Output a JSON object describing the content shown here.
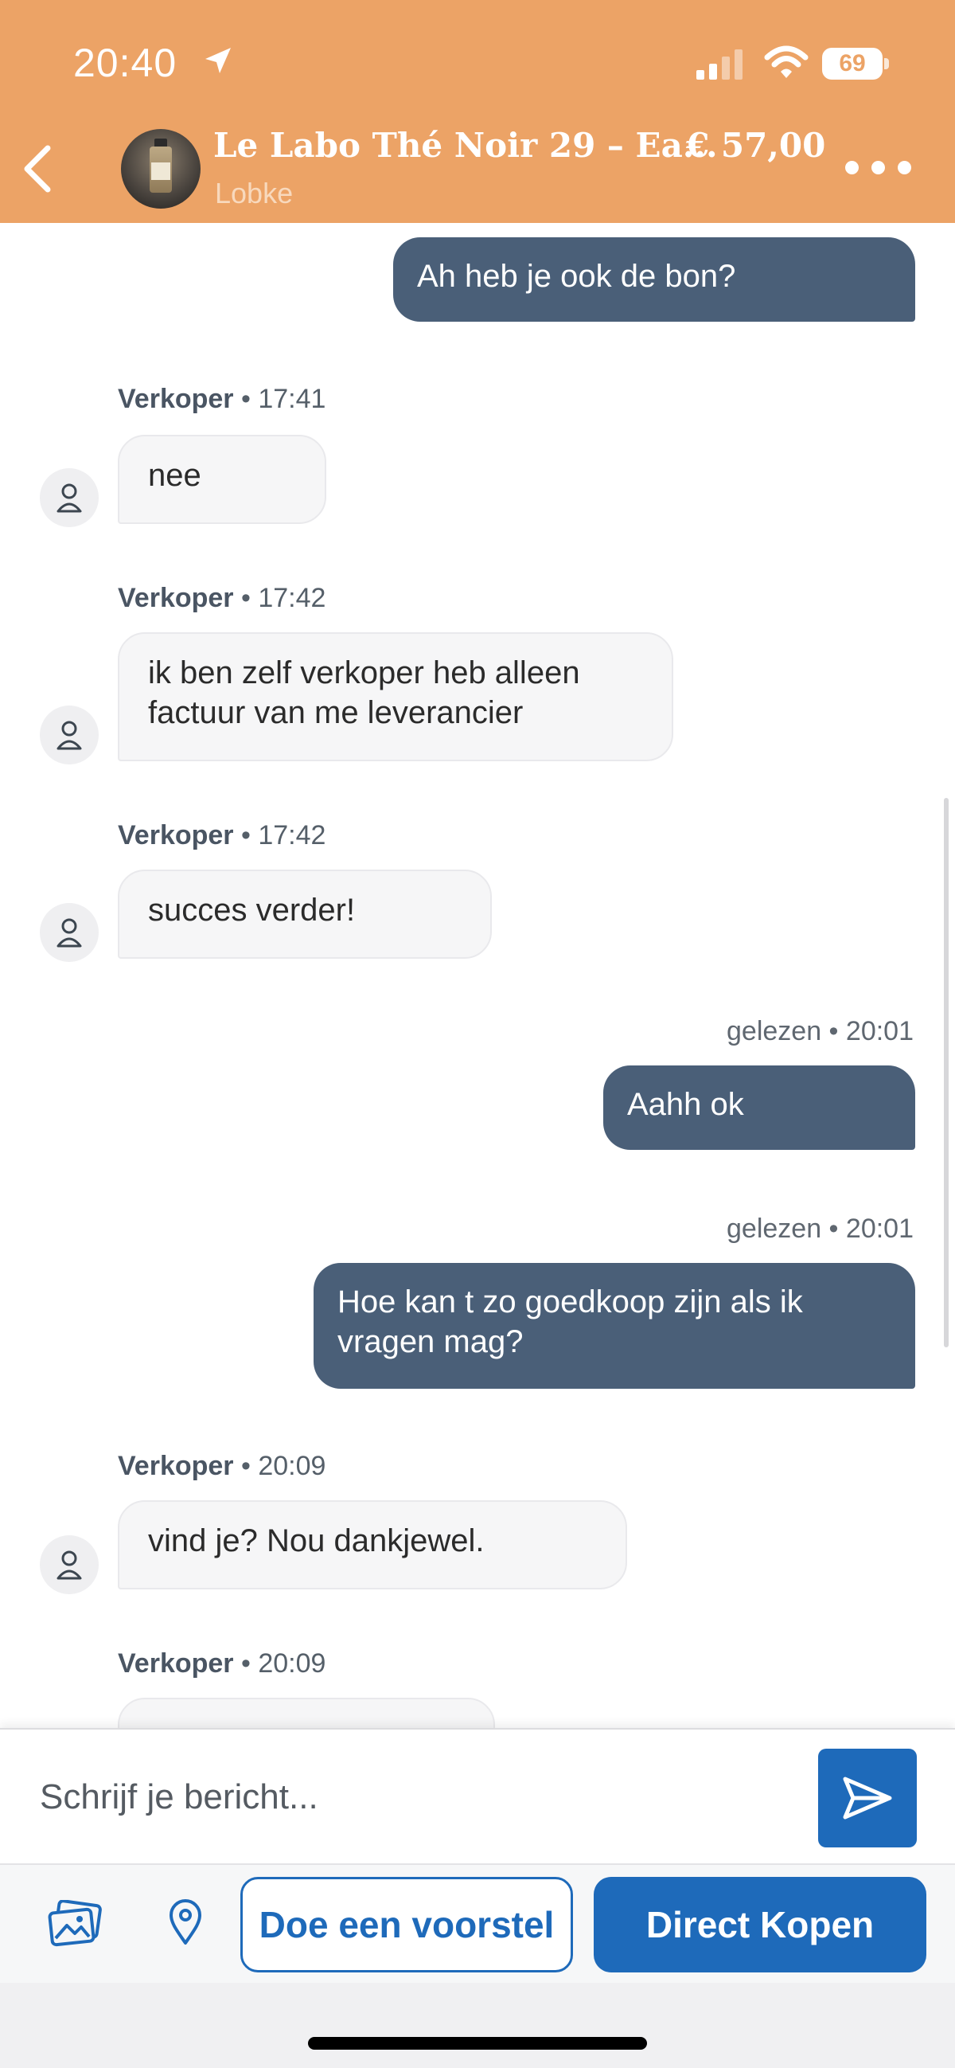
{
  "status_bar": {
    "time": "20:40",
    "battery": "69"
  },
  "header": {
    "listing_title": "Le Labo Thé Noir 29 – Ea...",
    "price": "€ 57,00",
    "seller": "Lobke"
  },
  "messages": [
    {
      "direction": "out",
      "meta": "",
      "lines": [
        "Ah heb je ook de bon?"
      ]
    },
    {
      "direction": "in",
      "sender": "Verkoper",
      "time": "17:41",
      "lines": [
        "nee"
      ]
    },
    {
      "direction": "in",
      "sender": "Verkoper",
      "time": "17:42",
      "lines": [
        "ik ben zelf verkoper heb alleen",
        "factuur van me leverancier"
      ]
    },
    {
      "direction": "in",
      "sender": "Verkoper",
      "time": "17:42",
      "lines": [
        "succes verder!"
      ]
    },
    {
      "direction": "out",
      "status": "gelezen",
      "time": "20:01",
      "lines": [
        "Aahh ok"
      ]
    },
    {
      "direction": "out",
      "status": "gelezen",
      "time": "20:01",
      "lines": [
        "Hoe kan t zo goedkoop zijn als ik",
        "vragen mag?"
      ]
    },
    {
      "direction": "in",
      "sender": "Verkoper",
      "time": "20:09",
      "lines": [
        "vind je? Nou dankjewel."
      ]
    },
    {
      "direction": "in",
      "sender": "Verkoper",
      "time": "20:09",
      "lines": [
        ""
      ]
    }
  ],
  "meta_separator": " • ",
  "composer": {
    "placeholder": "Schrijf je bericht..."
  },
  "actions": {
    "offer_label": "Doe een voorstel",
    "buy_label": "Direct Kopen"
  },
  "colors": {
    "header": "#eca366",
    "outgoing_bubble": "#4a5f78",
    "accent": "#1e6aba"
  },
  "icons": [
    "location-arrow-icon",
    "signal-icon",
    "wifi-icon",
    "battery-icon",
    "back-chevron-icon",
    "more-dots-icon",
    "user-icon",
    "send-icon",
    "gallery-icon",
    "map-pin-icon"
  ]
}
